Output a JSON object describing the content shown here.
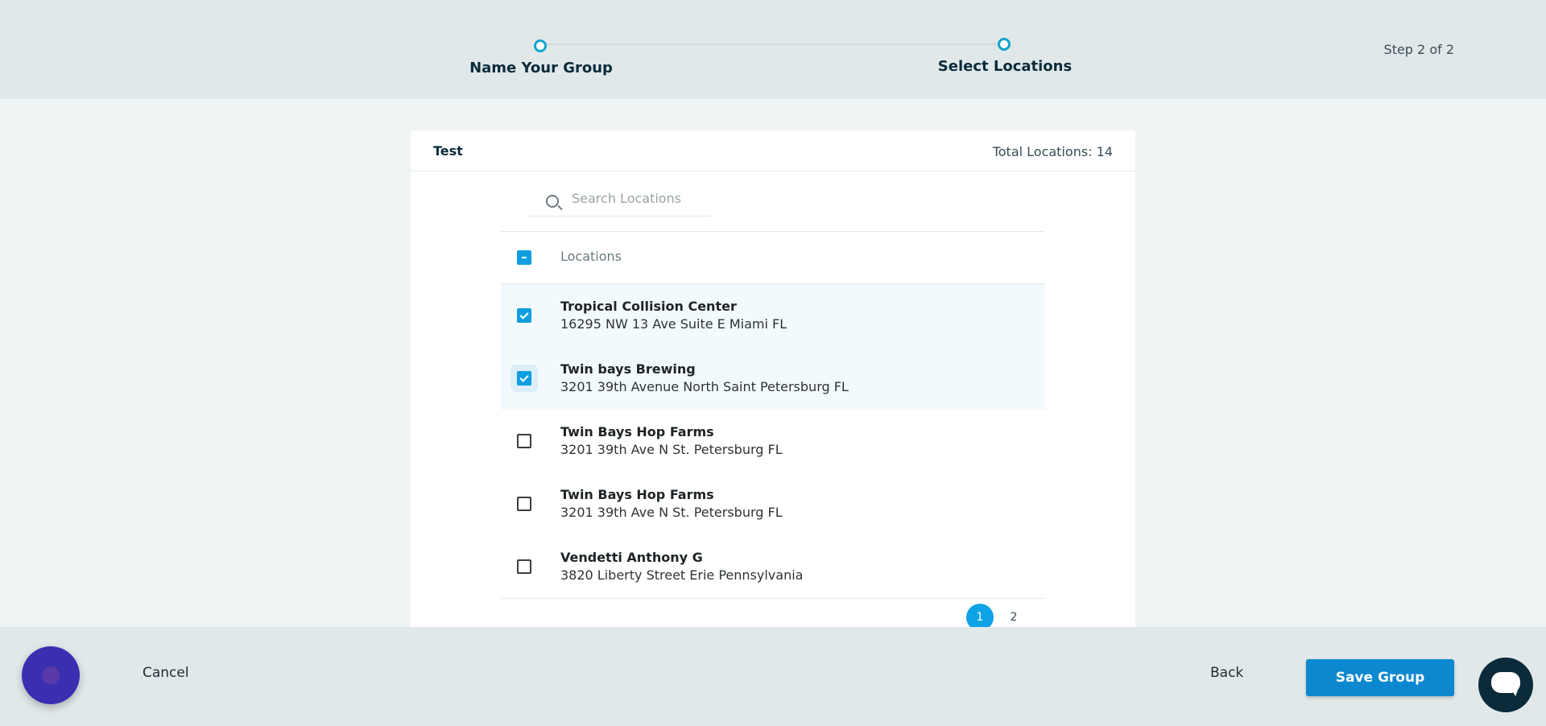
{
  "stepper": {
    "steps": [
      {
        "label": "Name Your Group"
      },
      {
        "label": "Select Locations"
      }
    ],
    "step_count": "Step 2 of 2"
  },
  "card": {
    "group_name": "Test",
    "total_label": "Total Locations: 14"
  },
  "search": {
    "placeholder": "Search Locations",
    "icon": "search-icon"
  },
  "table": {
    "header_label": "Locations",
    "select_all_state": "partial",
    "rows": [
      {
        "name": "Tropical Collision Center",
        "address": "16295 NW 13 Ave Suite E Miami FL",
        "checked": true
      },
      {
        "name": "Twin bays Brewing",
        "address": "3201 39th Avenue North Saint Petersburg FL",
        "checked": true
      },
      {
        "name": "Twin Bays Hop Farms",
        "address": "3201 39th Ave N St. Petersburg FL",
        "checked": false
      },
      {
        "name": "Twin Bays Hop Farms",
        "address": "3201 39th Ave N St. Petersburg FL",
        "checked": false
      },
      {
        "name": "Vendetti Anthony G",
        "address": "3820 Liberty Street Erie Pennsylvania",
        "checked": false
      }
    ]
  },
  "pagination": {
    "pages": [
      "1",
      "2"
    ],
    "current": "1"
  },
  "footer": {
    "cancel_label": "Cancel",
    "back_label": "Back",
    "save_label": "Save Group"
  },
  "colors": {
    "accent": "#0f9fe0",
    "primary_button": "#0b88cf",
    "step_dot": "#13a5c8",
    "header_bg": "#e1e8ea"
  }
}
